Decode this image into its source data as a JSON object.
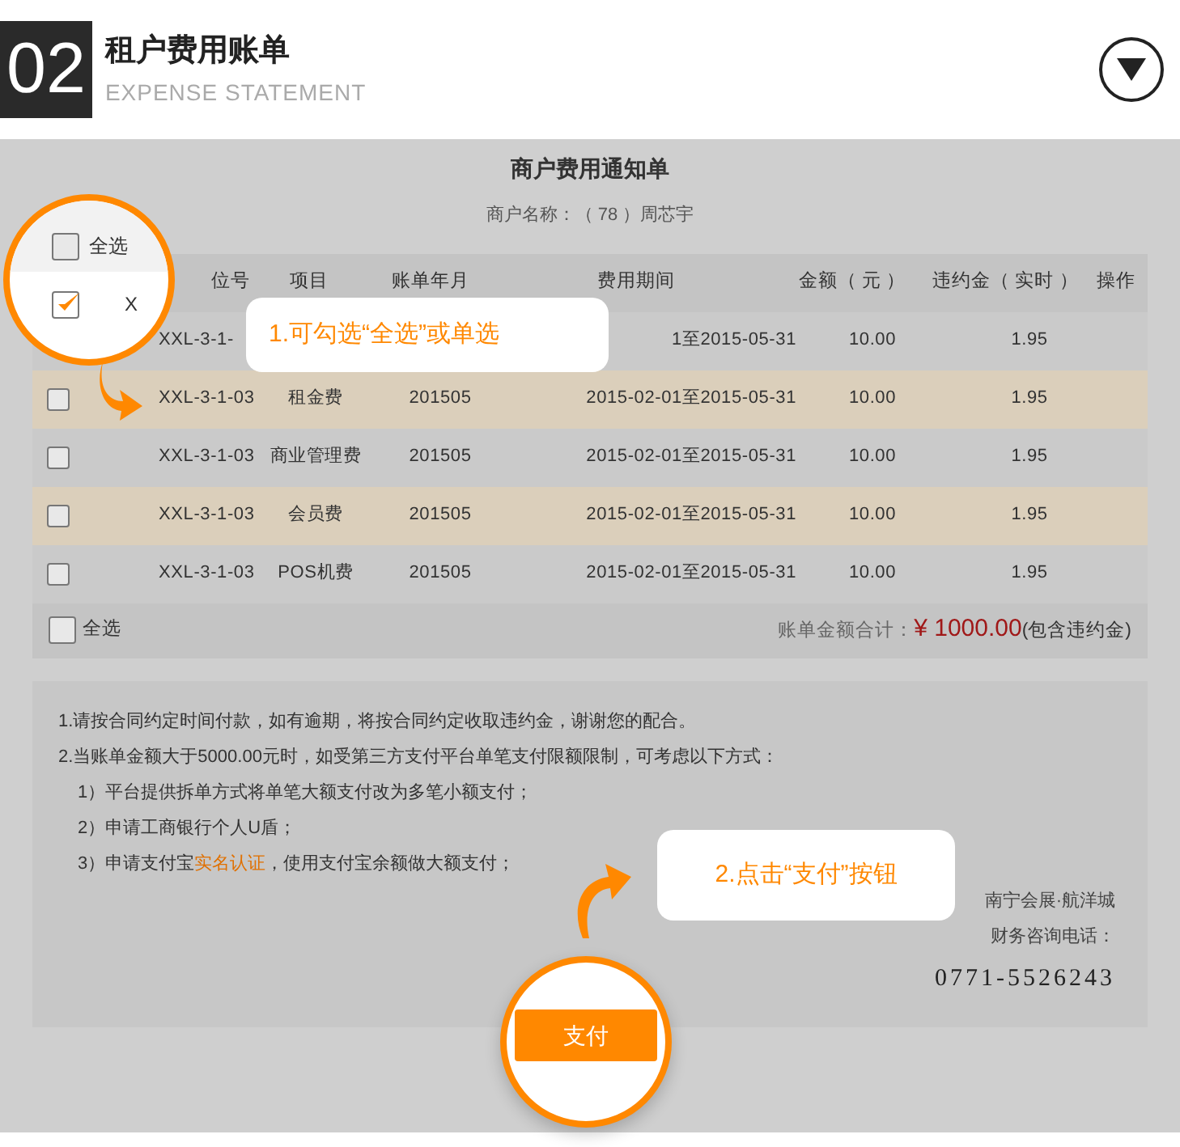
{
  "header": {
    "number": "02",
    "title": "租户费用账单",
    "subtitle": "EXPENSE STATEMENT"
  },
  "notice": {
    "title": "商户费用通知单",
    "merchant": "商户名称：（ 78 ）周芯宇"
  },
  "table": {
    "columns": [
      "位号",
      "项目",
      "账单年月",
      "费用期间",
      "金额（ 元 ）",
      "违约金（ 实时 ）",
      "操作"
    ],
    "rows": [
      {
        "highlighted": false,
        "unit": "XXL-3-1-",
        "period": "1至2015-05-31",
        "amount": "10.00",
        "penalty": "1.95"
      },
      {
        "checked": false,
        "highlighted": true,
        "unit": "XXL-3-1-03",
        "item": "租金费",
        "month": "201505",
        "period": "2015-02-01至2015-05-31",
        "amount": "10.00",
        "penalty": "1.95"
      },
      {
        "checked": false,
        "highlighted": false,
        "unit": "XXL-3-1-03",
        "item": "商业管理费",
        "month": "201505",
        "period": "2015-02-01至2015-05-31",
        "amount": "10.00",
        "penalty": "1.95"
      },
      {
        "checked": false,
        "highlighted": true,
        "unit": "XXL-3-1-03",
        "item": "会员费",
        "month": "201505",
        "period": "2015-02-01至2015-05-31",
        "amount": "10.00",
        "penalty": "1.95"
      },
      {
        "checked": false,
        "highlighted": false,
        "unit": "XXL-3-1-03",
        "item": "POS机费",
        "month": "201505",
        "period": "2015-02-01至2015-05-31",
        "amount": "10.00",
        "penalty": "1.95"
      }
    ],
    "footer": {
      "select_all": {
        "label": "全选",
        "checked": false
      },
      "total_label": "账单金额合计：",
      "total": "¥ 1000.00",
      "total_note": "(包含违约金)"
    }
  },
  "notes": [
    {
      "kind": "main",
      "text": "1.请按合同约定时间付款，如有逾期，将按合同约定收取违约金，谢谢您的配合。"
    },
    {
      "kind": "main",
      "text": "2.当账单金额大于5000.00元时，如受第三方支付平台单笔支付限额限制，可考虑以下方式："
    },
    {
      "kind": "sub",
      "text": "1）平台提供拆单方式将单笔大额支付改为多笔小额支付；"
    },
    {
      "kind": "sub",
      "text": "2）申请工商银行个人U盾；"
    },
    {
      "kind": "sub",
      "text": "3）申请支付宝",
      "link": "实名认证",
      "after": "，使用支付宝余额做大额支付；"
    }
  ],
  "contact": {
    "company": "南宁会展·航洋城",
    "phone_label": "财务咨询电话：",
    "phone": "0771-5526243"
  },
  "pay_button": "支付",
  "magnifier": {
    "select_all": {
      "label": "全选",
      "checked": false
    },
    "row": {
      "checked": true,
      "fragment": "X"
    }
  },
  "callouts": [
    "1.可勾选“全选”或单选",
    "2.点击“支付”按钮"
  ]
}
